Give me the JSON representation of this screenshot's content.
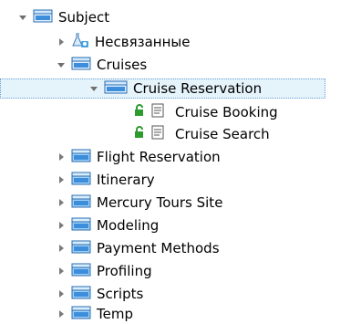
{
  "tree": {
    "root": {
      "label": "Subject",
      "expanded": true
    },
    "unattached": {
      "label": "Несвязанные"
    },
    "cruises": {
      "label": "Cruises",
      "expanded": true
    },
    "cruise_reservation": {
      "label": "Cruise Reservation",
      "expanded": true,
      "selected": true
    },
    "cruise_booking": {
      "label": "Cruise Booking"
    },
    "cruise_search": {
      "label": "Cruise Search"
    },
    "folders": [
      {
        "label": "Flight Reservation"
      },
      {
        "label": "Itinerary"
      },
      {
        "label": "Mercury Tours Site"
      },
      {
        "label": "Modeling"
      },
      {
        "label": "Payment Methods"
      },
      {
        "label": "Profiling"
      },
      {
        "label": "Scripts"
      },
      {
        "label": "Temp"
      }
    ]
  },
  "icons": {
    "folder": "folder-icon",
    "unattached": "unattached-items-icon",
    "test": "test-document-icon",
    "lock": "lock-icon",
    "expanded": "expanded-arrow-icon",
    "collapsed": "collapsed-arrow-icon"
  },
  "colors": {
    "folder_fill": "#3c8ddb",
    "folder_light": "#9fd0f5",
    "selection_bg": "#e5f3fb",
    "lock_green": "#2e9b2e",
    "arrow_gray": "#7a7a7a"
  }
}
